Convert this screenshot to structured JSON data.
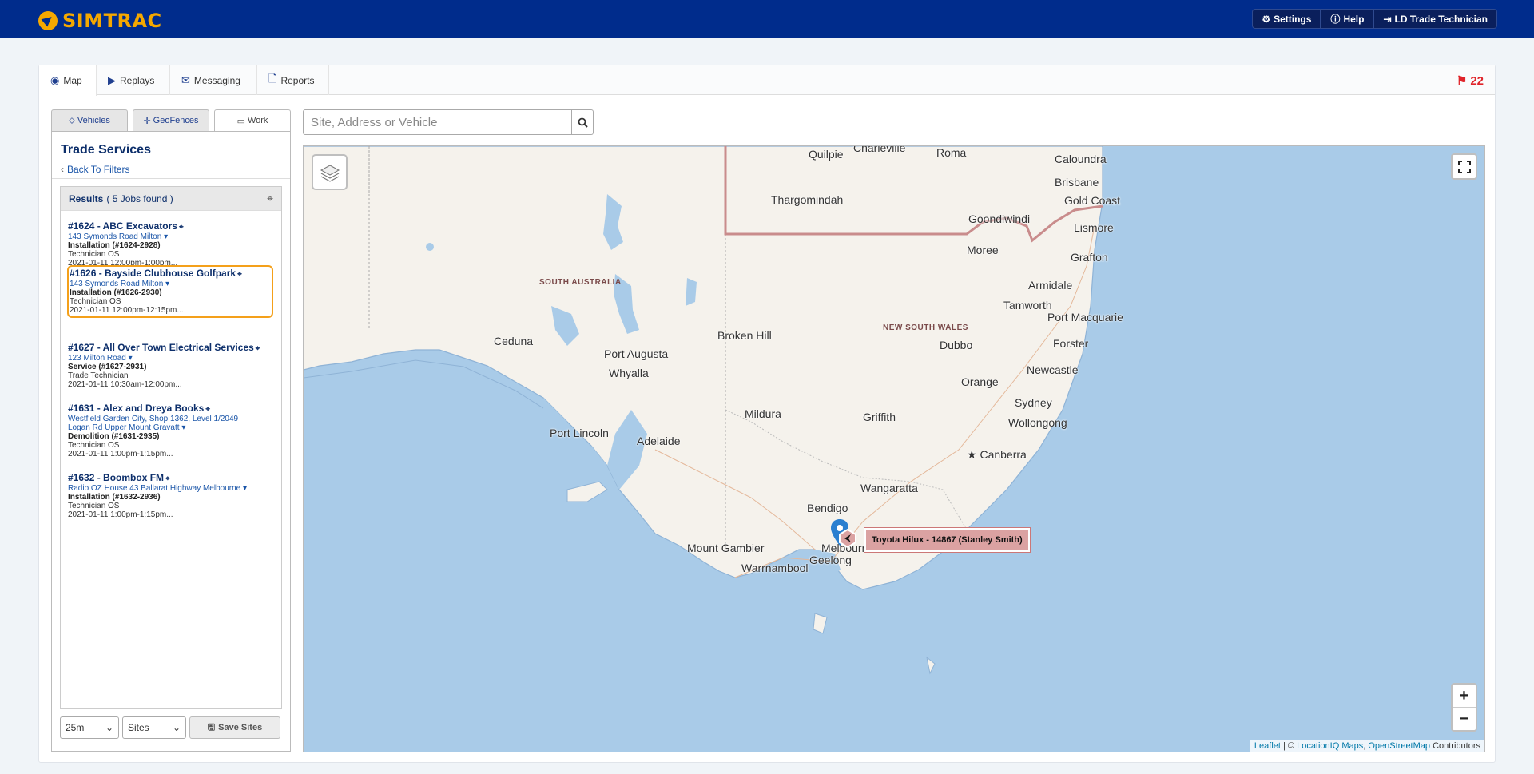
{
  "header": {
    "brand": "SIMTRAC",
    "buttons": [
      {
        "label": "Settings",
        "icon": "gear-icon"
      },
      {
        "label": "Help",
        "icon": "info-icon"
      },
      {
        "label": "LD Trade Technician",
        "icon": "sign-out-icon"
      }
    ]
  },
  "tabs": [
    {
      "label": "Map",
      "icon": "globe-icon"
    },
    {
      "label": "Replays",
      "icon": "play-icon"
    },
    {
      "label": "Messaging",
      "icon": "envelope-icon"
    },
    {
      "label": "Reports",
      "icon": "file-icon"
    }
  ],
  "alerts": {
    "count": "22",
    "color": "#e0242a"
  },
  "sidebar": {
    "subtabs": [
      "Vehicles",
      "GeoFences",
      "Work"
    ],
    "title": "Trade Services",
    "back_link": "Back To Filters",
    "results_label": "Results",
    "results_count": "( 5 Jobs found )",
    "jobs": [
      {
        "title": "#1624 - ABC Excavators",
        "address": "143 Symonds Road Milton",
        "type": "Installation (#1624-2928)",
        "tech": "Technician OS",
        "time": "2021-01-11 12:00pm-1:00pm..."
      },
      {
        "title": "#1626 - Bayside Clubhouse Golfpark",
        "address": "143 Symonds Road Milton",
        "type": "Installation (#1626-2930)",
        "tech": "Technician OS",
        "time": "2021-01-11 12:00pm-12:15pm..."
      },
      {
        "title": "#1627 - All Over Town Electrical Services",
        "address": "123 Milton Road",
        "type": "Service (#1627-2931)",
        "tech": "Trade Technician",
        "time": "2021-01-11 10:30am-12:00pm..."
      },
      {
        "title": "#1631 - Alex and Dreya Books",
        "address": "Westfield Garden City, Shop 1362, Level 1/2049",
        "address2": "Logan Rd Upper Mount Gravatt",
        "type": "Demolition (#1631-2935)",
        "tech": "Technician OS",
        "time": "2021-01-11 1:00pm-1:15pm..."
      },
      {
        "title": "#1632 - Boombox FM",
        "address": "Radio OZ House 43 Ballarat Highway Melbourne",
        "type": "Installation (#1632-2936)",
        "tech": "Technician OS",
        "time": "2021-01-11 1:00pm-1:15pm..."
      }
    ],
    "radius_select": "25m",
    "type_select": "Sites",
    "save_label": "Save Sites"
  },
  "search": {
    "placeholder": "Site, Address or Vehicle"
  },
  "map": {
    "places": [
      "Charleville",
      "Quilpie",
      "Roma",
      "Caloundra",
      "Brisbane",
      "Gold Coast",
      "Thargomindah",
      "Goondiwindi",
      "Moree",
      "Lismore",
      "Grafton",
      "Armidale",
      "Tamworth",
      "Port Macquarie",
      "Forster",
      "Newcastle",
      "Sydney",
      "Wollongong",
      "Canberra",
      "Dubbo",
      "Orange",
      "Griffith",
      "Wangaratta",
      "Bendigo",
      "Melbourne",
      "Geelong",
      "Warrnambool",
      "Mount Gambier",
      "Mildura",
      "Broken Hill",
      "Ceduna",
      "Port Augusta",
      "Whyalla",
      "Port Lincoln",
      "Adelaide"
    ],
    "regions": [
      "SOUTH AUSTRALIA",
      "NEW SOUTH WALES"
    ],
    "vehicle_label": "Toyota Hilux - 14867 (Stanley Smith)",
    "attribution_leaflet": "Leaflet",
    "attribution_sep": " | © ",
    "attribution_liq": "LocationIQ Maps",
    "attribution_comma": ", ",
    "attribution_osm": "OpenStreetMap",
    "attribution_tail": " Contributors",
    "zoom_in": "+",
    "zoom_out": "−",
    "land_color": "#f5f2ec",
    "water_color": "#a9cbe8"
  }
}
